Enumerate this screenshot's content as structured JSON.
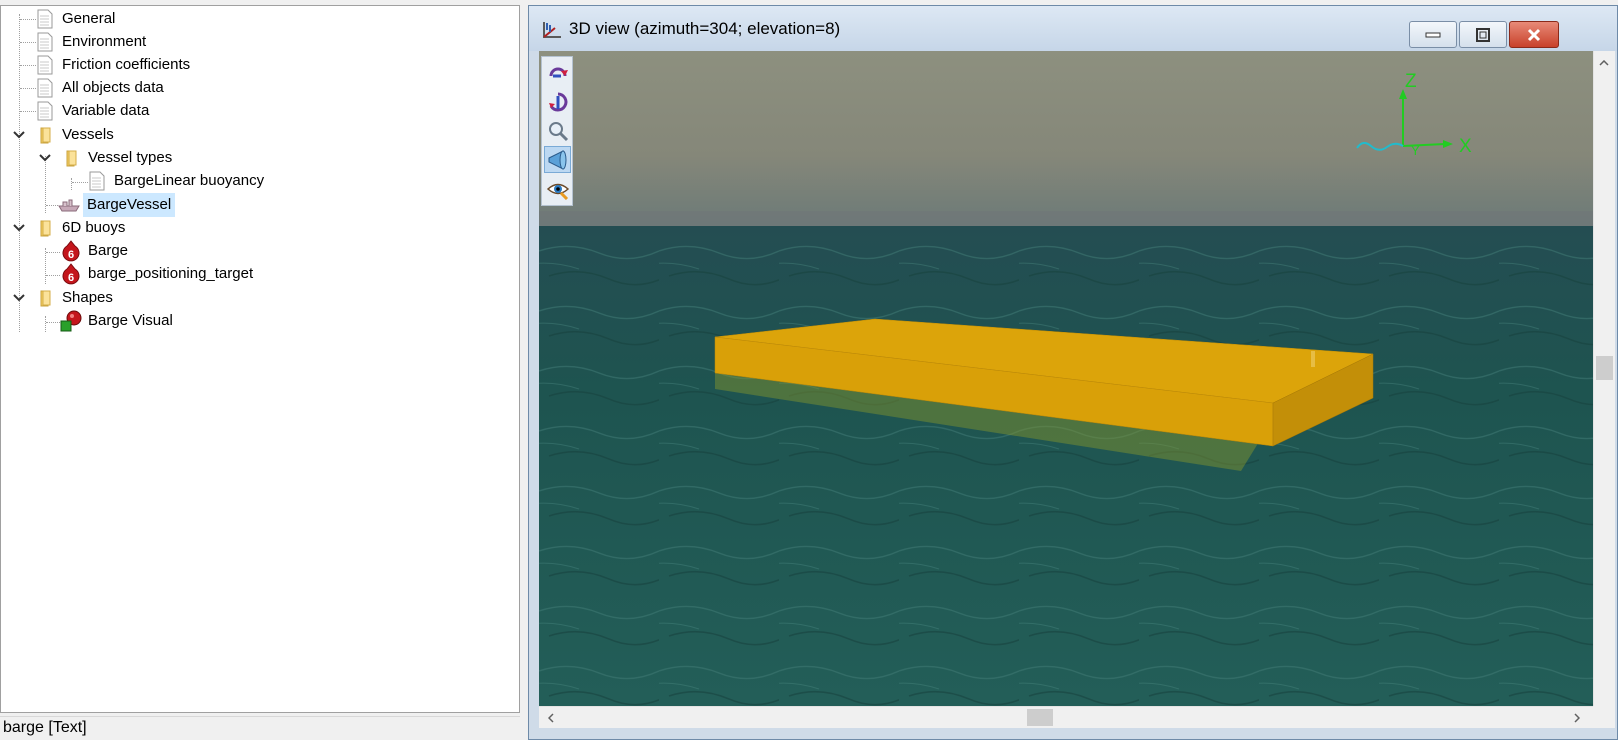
{
  "tree": {
    "items": [
      {
        "label": "General"
      },
      {
        "label": "Environment"
      },
      {
        "label": "Friction coefficients"
      },
      {
        "label": "All objects data"
      },
      {
        "label": "Variable data"
      },
      {
        "label": "Vessels"
      },
      {
        "label": "Vessel types"
      },
      {
        "label": "BargeLinear buoyancy"
      },
      {
        "label": "BargeVessel"
      },
      {
        "label": "6D buoys"
      },
      {
        "label": "Barge"
      },
      {
        "label": "barge_positioning_target"
      },
      {
        "label": "Shapes"
      },
      {
        "label": "Barge Visual"
      }
    ],
    "selected": "BargeVessel"
  },
  "status_bar": {
    "text": "barge [Text]"
  },
  "view_window": {
    "title": "3D view (azimuth=304; elevation=8)",
    "axes": {
      "z": "Z",
      "x": "X",
      "y": "Y"
    }
  },
  "colors": {
    "selection": "#cce8ff",
    "barge": "#dca40a",
    "sea": "#1e4f4c",
    "sky": "#8a8d7e",
    "axis_green": "#22cc22",
    "axis_cyan": "#22bbcc"
  }
}
